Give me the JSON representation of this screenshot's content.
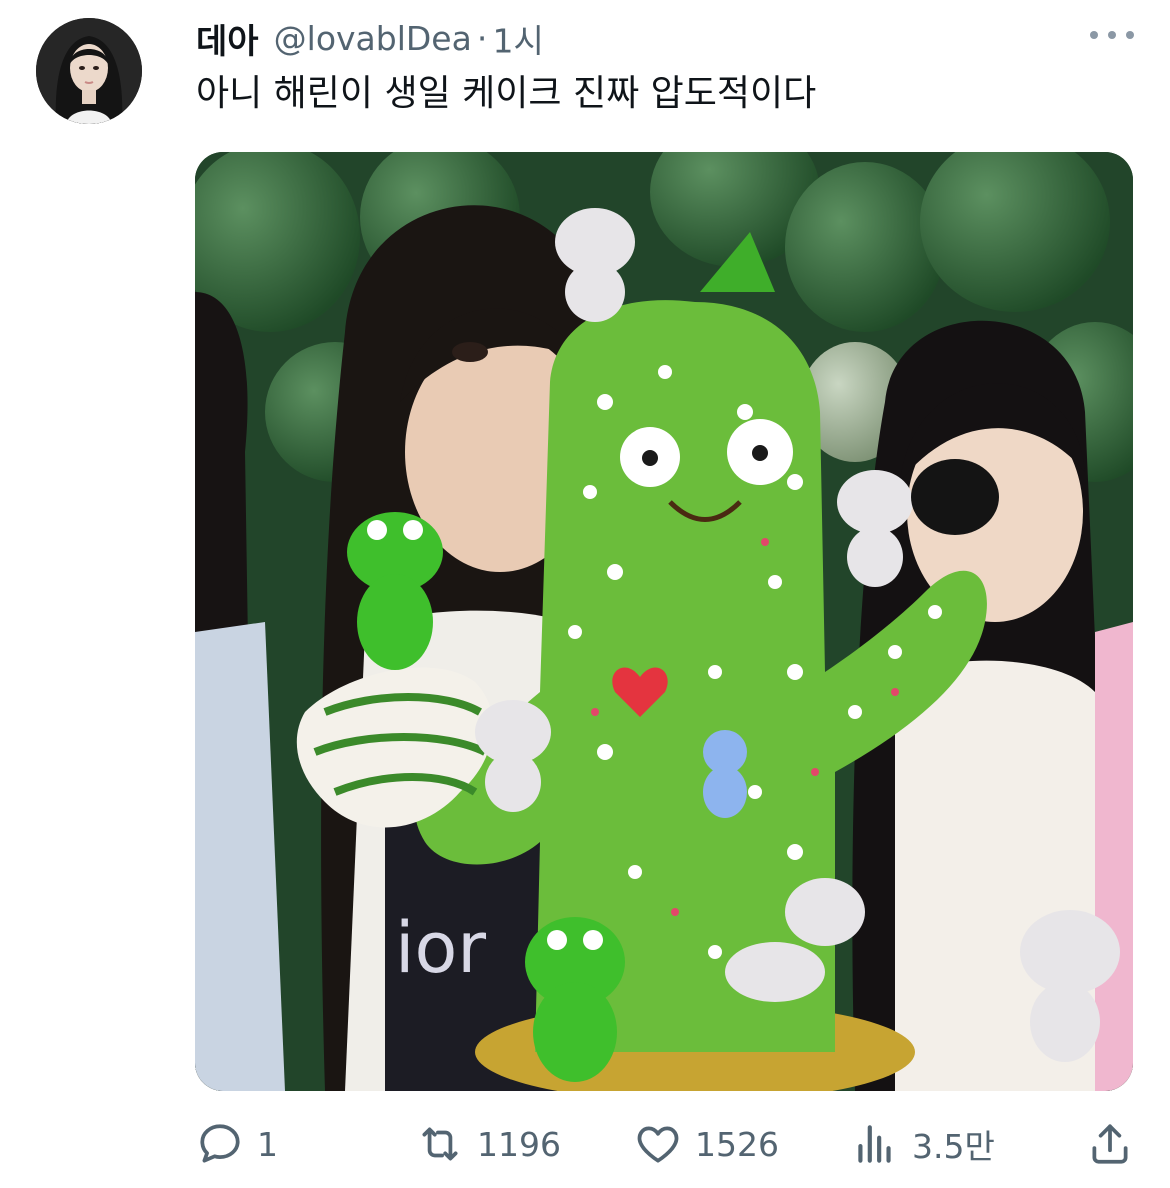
{
  "tweet": {
    "display_name": "데아",
    "handle": "@lovablDea",
    "separator": "·",
    "time": "1시",
    "text": "아니 해린이 생일 케이크 진짜 압도적이다"
  },
  "media": {
    "printed_text": "ior"
  },
  "actions": {
    "replies": "1",
    "retweets": "1196",
    "likes": "1526",
    "views": "3.5만"
  },
  "icons": {
    "more": "more-horizontal-icon",
    "reply": "reply-icon",
    "retweet": "retweet-icon",
    "like": "heart-icon",
    "views": "bar-chart-icon",
    "share": "share-icon"
  },
  "colors": {
    "text": "#0f1419",
    "secondary": "#536471"
  }
}
